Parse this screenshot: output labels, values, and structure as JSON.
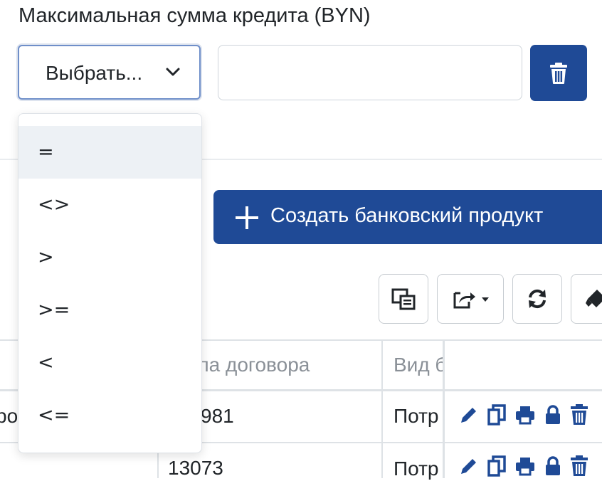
{
  "filter": {
    "label": "Максимальная сумма кредита (BYN)",
    "operator_placeholder": "Выбрать...",
    "value": ""
  },
  "operator_options": [
    "=",
    "<>",
    ">",
    ">=",
    "<",
    "<="
  ],
  "create_button": {
    "label": "Создать банковский продукт"
  },
  "toolbar_icons": [
    "columns-icon",
    "export-icon",
    "refresh-icon",
    "eraser-icon"
  ],
  "table": {
    "headers": [
      "",
      "типа договора",
      "Вид б"
    ],
    "rows": [
      {
        "col1": "ро",
        "col2": "981",
        "col3": "Потр"
      },
      {
        "col1": "",
        "col2": "13073",
        "col3": "Потр"
      }
    ]
  },
  "colors": {
    "primary": "#1f4a96",
    "dropdown_active": "#edf1f5"
  }
}
